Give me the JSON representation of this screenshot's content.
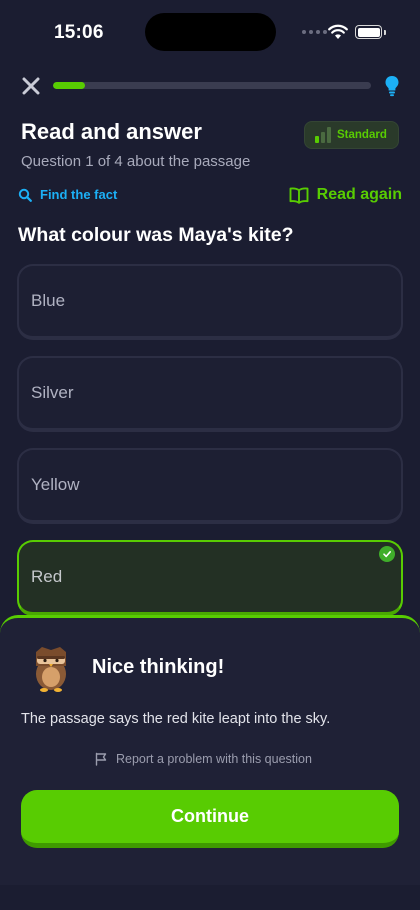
{
  "status_bar": {
    "time": "15:06"
  },
  "progress": {
    "fraction": 0.1
  },
  "header": {
    "title": "Read and answer",
    "subtitle": "Question 1 of 4 about the passage",
    "level_badge": "Standard"
  },
  "actions": {
    "find_fact": "Find the fact",
    "read_again": "Read again"
  },
  "question": {
    "text": "What colour was Maya's kite?",
    "options": [
      {
        "label": "Blue",
        "selected": false
      },
      {
        "label": "Silver",
        "selected": false
      },
      {
        "label": "Yellow",
        "selected": false
      },
      {
        "label": "Red",
        "selected": true
      }
    ]
  },
  "feedback": {
    "heading": "Nice thinking!",
    "body": "The passage says the red kite leapt into the sky.",
    "report": "Report a problem with this question",
    "continue_label": "Continue"
  },
  "colors": {
    "accent": "#58cc02",
    "link": "#1cb0f6",
    "background": "#1b1d31"
  },
  "icons": {
    "close": "close-icon",
    "hint": "lightbulb-icon",
    "find_fact": "search-icon",
    "read_again": "book-icon",
    "check": "check-icon",
    "report": "flag-icon"
  }
}
